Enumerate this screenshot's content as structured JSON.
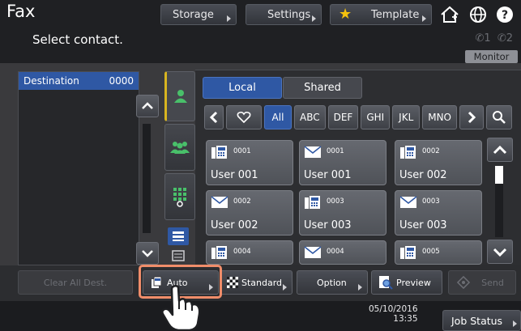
{
  "app": {
    "title": "Fax"
  },
  "topnav": {
    "storage_label": "Storage",
    "settings_label": "Settings",
    "template_label": "Template"
  },
  "instruction": "Select contact.",
  "lines": {
    "line1": "1",
    "line2": "2"
  },
  "monitor_label": "Monitor",
  "destination": {
    "label": "Destination",
    "count": "0000"
  },
  "address_book": {
    "local_label": "Local",
    "shared_label": "Shared",
    "filters": [
      "All",
      "ABC",
      "DEF",
      "GHI",
      "JKL",
      "MNO"
    ],
    "selected_filter": "All",
    "contacts": [
      {
        "number": "0001",
        "name": "User 001",
        "type": "fax-icon"
      },
      {
        "number": "0001",
        "name": "User 001",
        "type": "email-icon"
      },
      {
        "number": "0002",
        "name": "User 002",
        "type": "fax-icon"
      },
      {
        "number": "0002",
        "name": "User 002",
        "type": "email-icon"
      },
      {
        "number": "0003",
        "name": "User 003",
        "type": "fax-icon"
      },
      {
        "number": "0003",
        "name": "User 003",
        "type": "email-icon"
      },
      {
        "number": "0004",
        "name": "",
        "type": "fax-icon"
      },
      {
        "number": "0004",
        "name": "",
        "type": "email-icon"
      },
      {
        "number": "0005",
        "name": "",
        "type": "fax-icon"
      }
    ]
  },
  "actions": {
    "clear_all": "Clear All Dest.",
    "auto": "Auto",
    "standard": "Standard",
    "option": "Option",
    "preview": "Preview",
    "send": "Send"
  },
  "status": {
    "date": "05/10/2016",
    "time": "13:35",
    "job_status": "Job Status"
  },
  "colors": {
    "accent_blue": "#2f58a4",
    "highlight": "#f08d6a",
    "active_tab": "#d8b520",
    "user_icon_green": "#49c06a"
  }
}
